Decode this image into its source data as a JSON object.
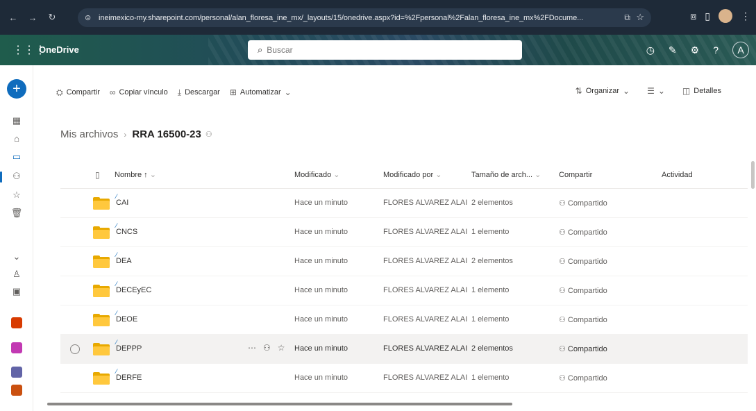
{
  "browser": {
    "url": "ineimexico-my.sharepoint.com/personal/alan_floresa_ine_mx/_layouts/15/onedrive.aspx?id=%2Fpersonal%2Falan_floresa_ine_mx%2FDocume...",
    "icons": [
      "back-icon",
      "forward-icon",
      "reload-icon",
      "site-info-icon",
      "cast-icon",
      "star-icon",
      "extensions-icon",
      "sidepanel-icon",
      "profile-avatar",
      "menu-icon"
    ]
  },
  "suite": {
    "app_name": "OneDrive",
    "search_placeholder": "Buscar",
    "accent": "#0f6cbd"
  },
  "commands": {
    "share": "Compartir",
    "copy_link": "Copiar vínculo",
    "download": "Descargar",
    "automate": "Automatizar",
    "organize": "Organizar",
    "details": "Detalles"
  },
  "breadcrumb": {
    "root": "Mis archivos",
    "current": "RRA 16500-23"
  },
  "columns": {
    "name": "Nombre ↑",
    "modified": "Modificado",
    "modified_by": "Modificado por",
    "size": "Tamaño de arch...",
    "sharing": "Compartir",
    "activity": "Actividad"
  },
  "rows": [
    {
      "name": "CAI",
      "modified": "Hace un minuto",
      "modified_by": "FLORES ALVAREZ ALAI",
      "size": "2 elementos",
      "sharing": "Compartido"
    },
    {
      "name": "CNCS",
      "modified": "Hace un minuto",
      "modified_by": "FLORES ALVAREZ ALAI",
      "size": "1 elemento",
      "sharing": "Compartido"
    },
    {
      "name": "DEA",
      "modified": "Hace un minuto",
      "modified_by": "FLORES ALVAREZ ALAI",
      "size": "2 elementos",
      "sharing": "Compartido"
    },
    {
      "name": "DECEyEC",
      "modified": "Hace un minuto",
      "modified_by": "FLORES ALVAREZ ALAI",
      "size": "1 elemento",
      "sharing": "Compartido"
    },
    {
      "name": "DEOE",
      "modified": "Hace un minuto",
      "modified_by": "FLORES ALVAREZ ALAI",
      "size": "1 elemento",
      "sharing": "Compartido"
    },
    {
      "name": "DEPPP",
      "modified": "Hace un minuto",
      "modified_by": "FLORES ALVAREZ ALAI",
      "size": "2 elementos",
      "sharing": "Compartido"
    },
    {
      "name": "DERFE",
      "modified": "Hace un minuto",
      "modified_by": "FLORES ALVAREZ ALAI",
      "size": "1 elemento",
      "sharing": "Compartido"
    }
  ],
  "folder_colors": {
    "front": "#ffc83d",
    "back": "#e8a900"
  }
}
